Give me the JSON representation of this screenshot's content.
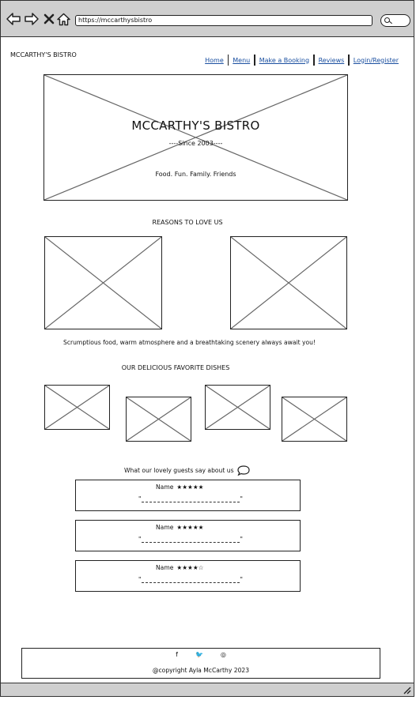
{
  "browser": {
    "url": "https://mccarthysbistro",
    "icons": [
      "back-arrow-icon",
      "forward-arrow-icon",
      "close-icon",
      "home-icon",
      "search-icon"
    ]
  },
  "header": {
    "brand": "MCCARTHY'S BISTRO",
    "nav": [
      "Home",
      "Menu",
      "Make a Booking",
      "Reviews",
      "Login/Register"
    ]
  },
  "hero": {
    "title": "MCCARTHY'S BISTRO",
    "since": "----Since 2003----",
    "tagline": "Food. Fun. Family. Friends"
  },
  "reasons": {
    "heading": "REASONS TO LOVE US",
    "text": "Scrumptious food, warm atmosphere and a breathtaking scenery always await you!"
  },
  "dishes": {
    "heading": "OUR DELICIOUS FAVORITE DISHES"
  },
  "testimonials": {
    "heading": "What our lovely guests say about us",
    "reviews": [
      {
        "name": "Name",
        "stars": "★★★★★",
        "open_quote": "\"",
        "close_quote": "\""
      },
      {
        "name": "Name",
        "stars": "★★★★★",
        "open_quote": "\"",
        "close_quote": "\""
      },
      {
        "name": "Name",
        "stars": "★★★★☆",
        "open_quote": "\"",
        "close_quote": "\""
      }
    ]
  },
  "footer": {
    "social": [
      "f",
      "🐦",
      "◎"
    ],
    "copyright": "@copyright Ayla McCarthy 2023"
  }
}
